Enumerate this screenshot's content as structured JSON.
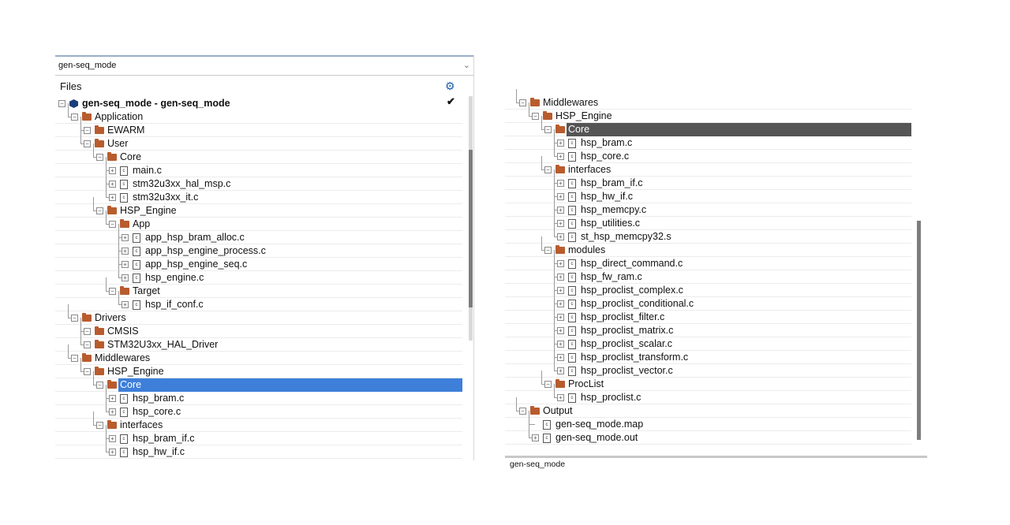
{
  "left": {
    "combo_value": "gen-seq_mode",
    "files_label": "Files",
    "project_title": "gen-seq_mode - gen-seq_mode",
    "rows": [
      {
        "level": 0,
        "kind": "folder",
        "label": "Application"
      },
      {
        "level": 1,
        "kind": "folder",
        "label": "EWARM"
      },
      {
        "level": 1,
        "kind": "folder",
        "label": "User"
      },
      {
        "level": 2,
        "kind": "folder",
        "label": "Core"
      },
      {
        "level": 3,
        "kind": "file",
        "label": "main.c"
      },
      {
        "level": 3,
        "kind": "file",
        "label": "stm32u3xx_hal_msp.c"
      },
      {
        "level": 3,
        "kind": "file",
        "label": "stm32u3xx_it.c"
      },
      {
        "level": 2,
        "kind": "folder",
        "label": "HSP_Engine"
      },
      {
        "level": 3,
        "kind": "folder",
        "label": "App"
      },
      {
        "level": 4,
        "kind": "file",
        "label": "app_hsp_bram_alloc.c"
      },
      {
        "level": 4,
        "kind": "file",
        "label": "app_hsp_engine_process.c"
      },
      {
        "level": 4,
        "kind": "file",
        "label": "app_hsp_engine_seq.c"
      },
      {
        "level": 4,
        "kind": "file",
        "label": "hsp_engine.c"
      },
      {
        "level": 3,
        "kind": "folder",
        "label": "Target"
      },
      {
        "level": 4,
        "kind": "file",
        "label": "hsp_if_conf.c"
      },
      {
        "level": 0,
        "kind": "folder",
        "label": "Drivers"
      },
      {
        "level": 1,
        "kind": "folder",
        "label": "CMSIS"
      },
      {
        "level": 1,
        "kind": "folder",
        "label": "STM32U3xx_HAL_Driver"
      },
      {
        "level": 0,
        "kind": "folder",
        "label": "Middlewares"
      },
      {
        "level": 1,
        "kind": "folder",
        "label": "HSP_Engine"
      },
      {
        "level": 2,
        "kind": "folder",
        "label": "Core",
        "selected": true
      },
      {
        "level": 3,
        "kind": "file",
        "label": "hsp_bram.c"
      },
      {
        "level": 3,
        "kind": "file",
        "label": "hsp_core.c"
      },
      {
        "level": 2,
        "kind": "folder",
        "label": "interfaces"
      },
      {
        "level": 3,
        "kind": "file",
        "label": "hsp_bram_if.c"
      },
      {
        "level": 3,
        "kind": "file",
        "label": "hsp_hw_if.c"
      }
    ]
  },
  "right": {
    "bottom_tab_label": "gen-seq_mode",
    "rows": [
      {
        "level": 0,
        "kind": "folder",
        "label": "Middlewares"
      },
      {
        "level": 1,
        "kind": "folder",
        "label": "HSP_Engine"
      },
      {
        "level": 2,
        "kind": "folder",
        "label": "Core",
        "selected": true
      },
      {
        "level": 3,
        "kind": "file",
        "label": "hsp_bram.c"
      },
      {
        "level": 3,
        "kind": "file",
        "label": "hsp_core.c"
      },
      {
        "level": 2,
        "kind": "folder",
        "label": "interfaces"
      },
      {
        "level": 3,
        "kind": "file",
        "label": "hsp_bram_if.c"
      },
      {
        "level": 3,
        "kind": "file",
        "label": "hsp_hw_if.c"
      },
      {
        "level": 3,
        "kind": "file",
        "label": "hsp_memcpy.c"
      },
      {
        "level": 3,
        "kind": "file",
        "label": "hsp_utilities.c"
      },
      {
        "level": 3,
        "kind": "file",
        "label": "st_hsp_memcpy32.s"
      },
      {
        "level": 2,
        "kind": "folder",
        "label": "modules"
      },
      {
        "level": 3,
        "kind": "file",
        "label": "hsp_direct_command.c"
      },
      {
        "level": 3,
        "kind": "file",
        "label": "hsp_fw_ram.c"
      },
      {
        "level": 3,
        "kind": "file",
        "label": "hsp_proclist_complex.c"
      },
      {
        "level": 3,
        "kind": "file",
        "label": "hsp_proclist_conditional.c"
      },
      {
        "level": 3,
        "kind": "file",
        "label": "hsp_proclist_filter.c"
      },
      {
        "level": 3,
        "kind": "file",
        "label": "hsp_proclist_matrix.c"
      },
      {
        "level": 3,
        "kind": "file",
        "label": "hsp_proclist_scalar.c"
      },
      {
        "level": 3,
        "kind": "file",
        "label": "hsp_proclist_transform.c"
      },
      {
        "level": 3,
        "kind": "file",
        "label": "hsp_proclist_vector.c"
      },
      {
        "level": 2,
        "kind": "folder",
        "label": "ProcList"
      },
      {
        "level": 3,
        "kind": "file",
        "label": "hsp_proclist.c"
      },
      {
        "level": 0,
        "kind": "folder",
        "label": "Output"
      },
      {
        "level": 1,
        "kind": "output",
        "label": "gen-seq_mode.map",
        "leaf": true
      },
      {
        "level": 1,
        "kind": "output",
        "label": "gen-seq_mode.out"
      }
    ]
  },
  "colors": {
    "selection_left": "#3d7fd9",
    "selection_right": "#555555",
    "folder": "#b85c2e",
    "project_icon": "#1a3d7c"
  }
}
